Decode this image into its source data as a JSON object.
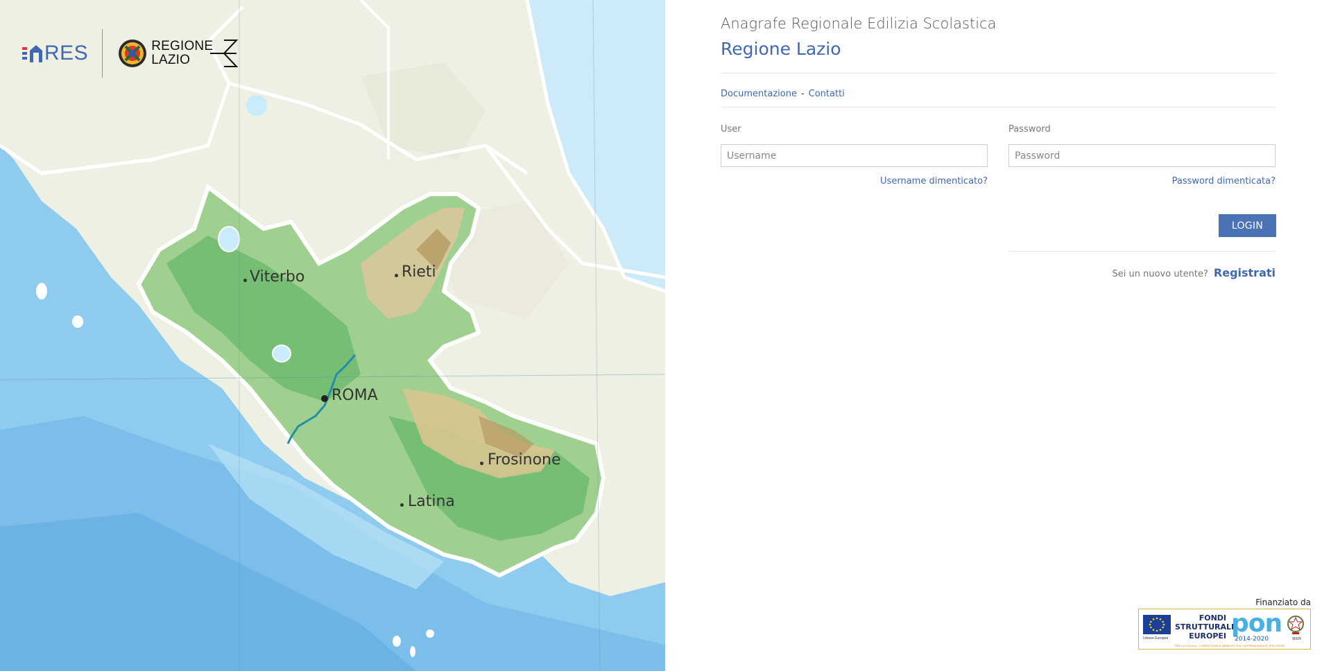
{
  "brand": {
    "ares_logo_text": "RES",
    "lazio_logo_line1": "REGIONE",
    "lazio_logo_line2": "LAZIO"
  },
  "map": {
    "cities": [
      {
        "name": "Viterbo"
      },
      {
        "name": "Rieti"
      },
      {
        "name": "ROMA"
      },
      {
        "name": "Frosinone"
      },
      {
        "name": "Latina"
      }
    ]
  },
  "header": {
    "subtitle": "Anagrafe Regionale Edilizia Scolastica",
    "title": "Regione Lazio"
  },
  "links": {
    "documentation": "Documentazione",
    "separator": "-",
    "contacts": "Contatti"
  },
  "login_form": {
    "user_label": "User",
    "user_placeholder": "Username",
    "user_value": "",
    "password_label": "Password",
    "password_placeholder": "Password",
    "password_value": "",
    "forgot_username": "Username dimenticato?",
    "forgot_password": "Password dimenticata?",
    "login_button": "LOGIN",
    "new_user_question": "Sei un nuovo utente?",
    "register_link": "Registrati"
  },
  "footer": {
    "funded_by": "Finanziato da",
    "eu_caption": "Unione Europea",
    "fondi_line1": "FONDI",
    "fondi_line2": "STRUTTURALI",
    "fondi_line3": "EUROPEI",
    "pon_text": "pon",
    "pon_years": "2014-2020",
    "pon_strip": "PER LA SCUOLA - COMPETENZE E AMBIENTI PER L'APPRENDIMENTO (FSE-FESR)",
    "miur_caption": "MIUR"
  },
  "colors": {
    "accent": "#3f68b0",
    "button": "#4a72b6",
    "sea": "#8cc9ee",
    "land": "#eef0e4",
    "region_green": "#8fc98f"
  },
  "icons": [
    "ares-logo-icon",
    "regione-lazio-emblem-icon",
    "eu-flag-icon",
    "italian-republic-emblem-icon"
  ]
}
